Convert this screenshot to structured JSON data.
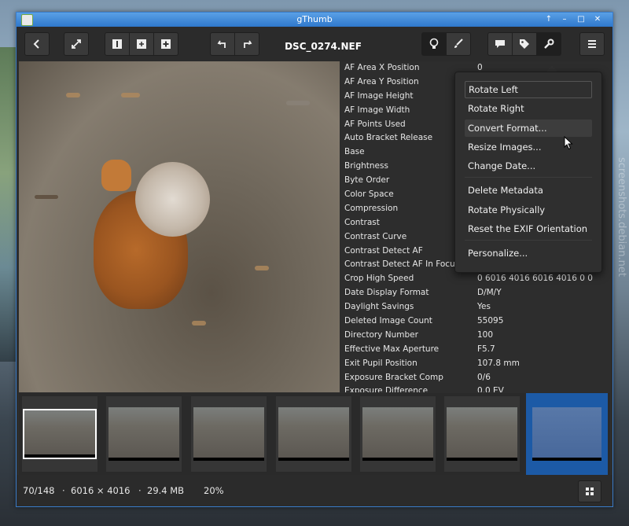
{
  "window": {
    "title": "gThumb"
  },
  "toolbar": {
    "file_name": "DSC_0274.NEF"
  },
  "metadata": [
    {
      "key": "AF Area X Position",
      "value": "0"
    },
    {
      "key": "AF Area Y Position",
      "value": ""
    },
    {
      "key": "AF Image Height",
      "value": ""
    },
    {
      "key": "AF Image Width",
      "value": ""
    },
    {
      "key": "AF Points Used",
      "value": ""
    },
    {
      "key": "Auto Bracket Release",
      "value": ""
    },
    {
      "key": "Base",
      "value": ""
    },
    {
      "key": "Brightness",
      "value": ""
    },
    {
      "key": "Byte Order",
      "value": ""
    },
    {
      "key": "Color Space",
      "value": ""
    },
    {
      "key": "Compression",
      "value": ""
    },
    {
      "key": "Contrast",
      "value": ""
    },
    {
      "key": "Contrast Curve",
      "value": ""
    },
    {
      "key": "Contrast Detect AF",
      "value": ""
    },
    {
      "key": "Contrast Detect AF In Focus",
      "value": ""
    },
    {
      "key": "Crop High Speed",
      "value": "0 6016 4016 6016 4016 0 0"
    },
    {
      "key": "Date Display Format",
      "value": "D/M/Y"
    },
    {
      "key": "Daylight Savings",
      "value": "Yes"
    },
    {
      "key": "Deleted Image Count",
      "value": "55095"
    },
    {
      "key": "Directory Number",
      "value": "100"
    },
    {
      "key": "Effective Max Aperture",
      "value": "F5.7"
    },
    {
      "key": "Exit Pupil Position",
      "value": "107.8 mm"
    },
    {
      "key": "Exposure Bracket Comp",
      "value": "0/6"
    },
    {
      "key": "Exposure Difference",
      "value": "0.0 EV"
    }
  ],
  "tools_menu": {
    "items": [
      "Rotate Left",
      "Rotate Right",
      "Convert Format...",
      "Resize Images...",
      "Change Date...",
      "Delete Metadata",
      "Rotate Physically",
      "Reset the EXIF Orientation",
      "Personalize..."
    ]
  },
  "status": {
    "position": "70/148",
    "dimensions": "6016 × 4016",
    "size": "29.4 MB",
    "zoom": "20%",
    "separator": "·"
  },
  "watermark": "screenshots.debian.net",
  "colors": {
    "accent": "#2f78cc",
    "selection": "#1c5aa6",
    "background": "#2d2d2d"
  }
}
